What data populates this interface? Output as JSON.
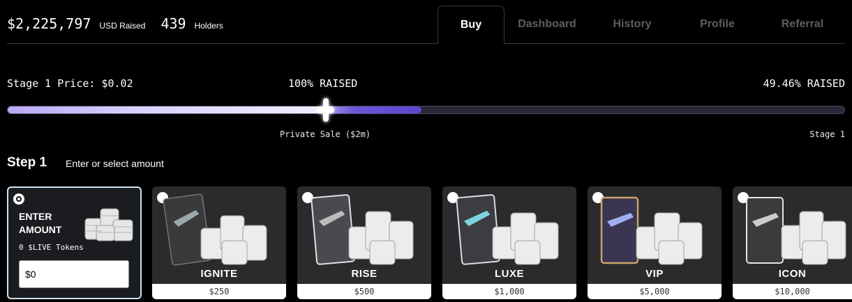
{
  "header": {
    "raised_amount": "$2,225,797",
    "raised_label": "USD Raised",
    "holders_count": "439",
    "holders_label": "Holders"
  },
  "tabs": [
    {
      "label": "Buy",
      "active": true
    },
    {
      "label": "Dashboard",
      "active": false
    },
    {
      "label": "History",
      "active": false
    },
    {
      "label": "Profile",
      "active": false
    },
    {
      "label": "Referral",
      "active": false
    }
  ],
  "progress": {
    "stage_price": "Stage 1 Price: $0.02",
    "private_raised": "100% RAISED",
    "stage_raised": "49.46% RAISED",
    "private_label": "Private Sale ($2m)",
    "stage_label": "Stage 1",
    "stage_fraction": 0.4946
  },
  "step": {
    "title": "Step 1",
    "subtitle": "Enter or select amount"
  },
  "enter_card": {
    "title": "ENTER AMOUNT",
    "tokens": "0 $LIVE Tokens",
    "input_value": "$0"
  },
  "packages": [
    {
      "name": "IGNITE",
      "price": "$250",
      "card_color": "#3a3a3d"
    },
    {
      "name": "RISE",
      "price": "$500",
      "card_color": "#d8d8dc"
    },
    {
      "name": "LUXE",
      "price": "$1,000",
      "card_color": "#dcdde2"
    },
    {
      "name": "VIP",
      "price": "$5,000",
      "card_color": "#c9a46a"
    },
    {
      "name": "ICON",
      "price": "$10,000",
      "card_color": "#e4e4e8"
    }
  ],
  "colors": {
    "accent": "#5b46cf",
    "selected_border": "#cfe3f2"
  }
}
